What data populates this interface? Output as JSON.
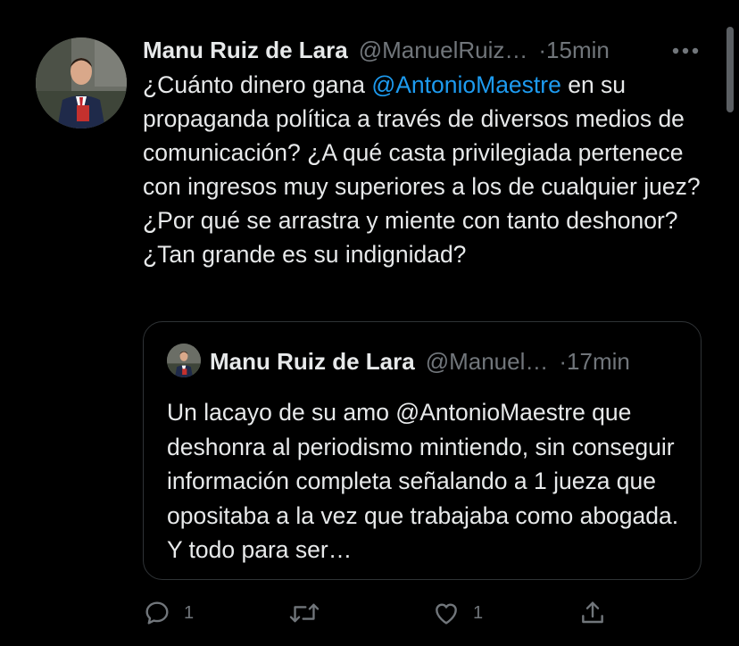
{
  "tweet": {
    "author_name": "Manu Ruiz de Lara",
    "handle": "@ManuelRuiz…",
    "time": "·15min",
    "text_before": "¿Cuánto dinero gana ",
    "mention": "@AntonioMaestre",
    "text_after": " en su propaganda política a través de diversos medios de comunicación? ¿A qué casta privilegiada pertenece con ingresos muy superiores a los de cualquier juez? ¿Por qué se arrastra y miente con tanto deshonor? ¿Tan grande es su indignidad?"
  },
  "quote": {
    "author_name": "Manu Ruiz de Lara",
    "handle": "@Manuel…",
    "time": "·17min",
    "text": "Un lacayo de su amo @AntonioMaestre que deshonra al periodismo mintiendo, sin conseguir información completa señalando a 1 jueza que opositaba a la vez que trabajaba como abogada. Y todo para ser…"
  },
  "actions": {
    "reply_count": "1",
    "retweet_count": "",
    "like_count": "1"
  },
  "icons": {
    "more": "more-dots-icon",
    "reply": "reply-icon",
    "retweet": "retweet-icon",
    "like": "heart-icon",
    "share": "share-icon"
  },
  "colors": {
    "background": "#000000",
    "text": "#e7e9ea",
    "secondary": "#71767b",
    "link": "#1d9bf0",
    "border": "#2f3336"
  }
}
